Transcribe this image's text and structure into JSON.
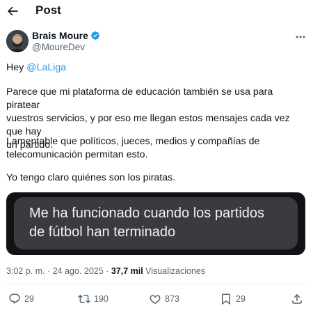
{
  "header": {
    "title": "Post",
    "back_icon": "arrow-left-icon"
  },
  "author": {
    "name": "Brais Moure",
    "handle": "@MoureDev",
    "verified_color": "#1d9bf0"
  },
  "tweet": {
    "greeting": "Hey ",
    "mention": "@LaLiga",
    "line_p2_1": "Parece que mi plataforma de educación también se usa para piratear",
    "line_p2_2": "vuestros servicios, y por eso me llegan estos mensajes cada vez que hay",
    "line_p2_3": "un partido.",
    "line_p3_1": "Lamentable que políticos, jueces, medios y compañías de",
    "line_p3_2": "telecomunicación permitan esto.",
    "line_p4": "Yo tengo claro quiénes son los piratas."
  },
  "media": {
    "line1": "Me ha funcionado cuando los partidos",
    "line2": "de fútbol han terminado"
  },
  "meta": {
    "time": "3:02 p. m.",
    "separator": " · ",
    "date": "24 ago. 2025",
    "views_count": "37,7 mil",
    "views_label": " Visualizaciones"
  },
  "actions": {
    "replies": "29",
    "reposts": "190",
    "likes": "873",
    "bookmarks": "29"
  },
  "colors": {
    "accent": "#1d9bf0",
    "text": "#0f1419",
    "muted": "#536471"
  }
}
